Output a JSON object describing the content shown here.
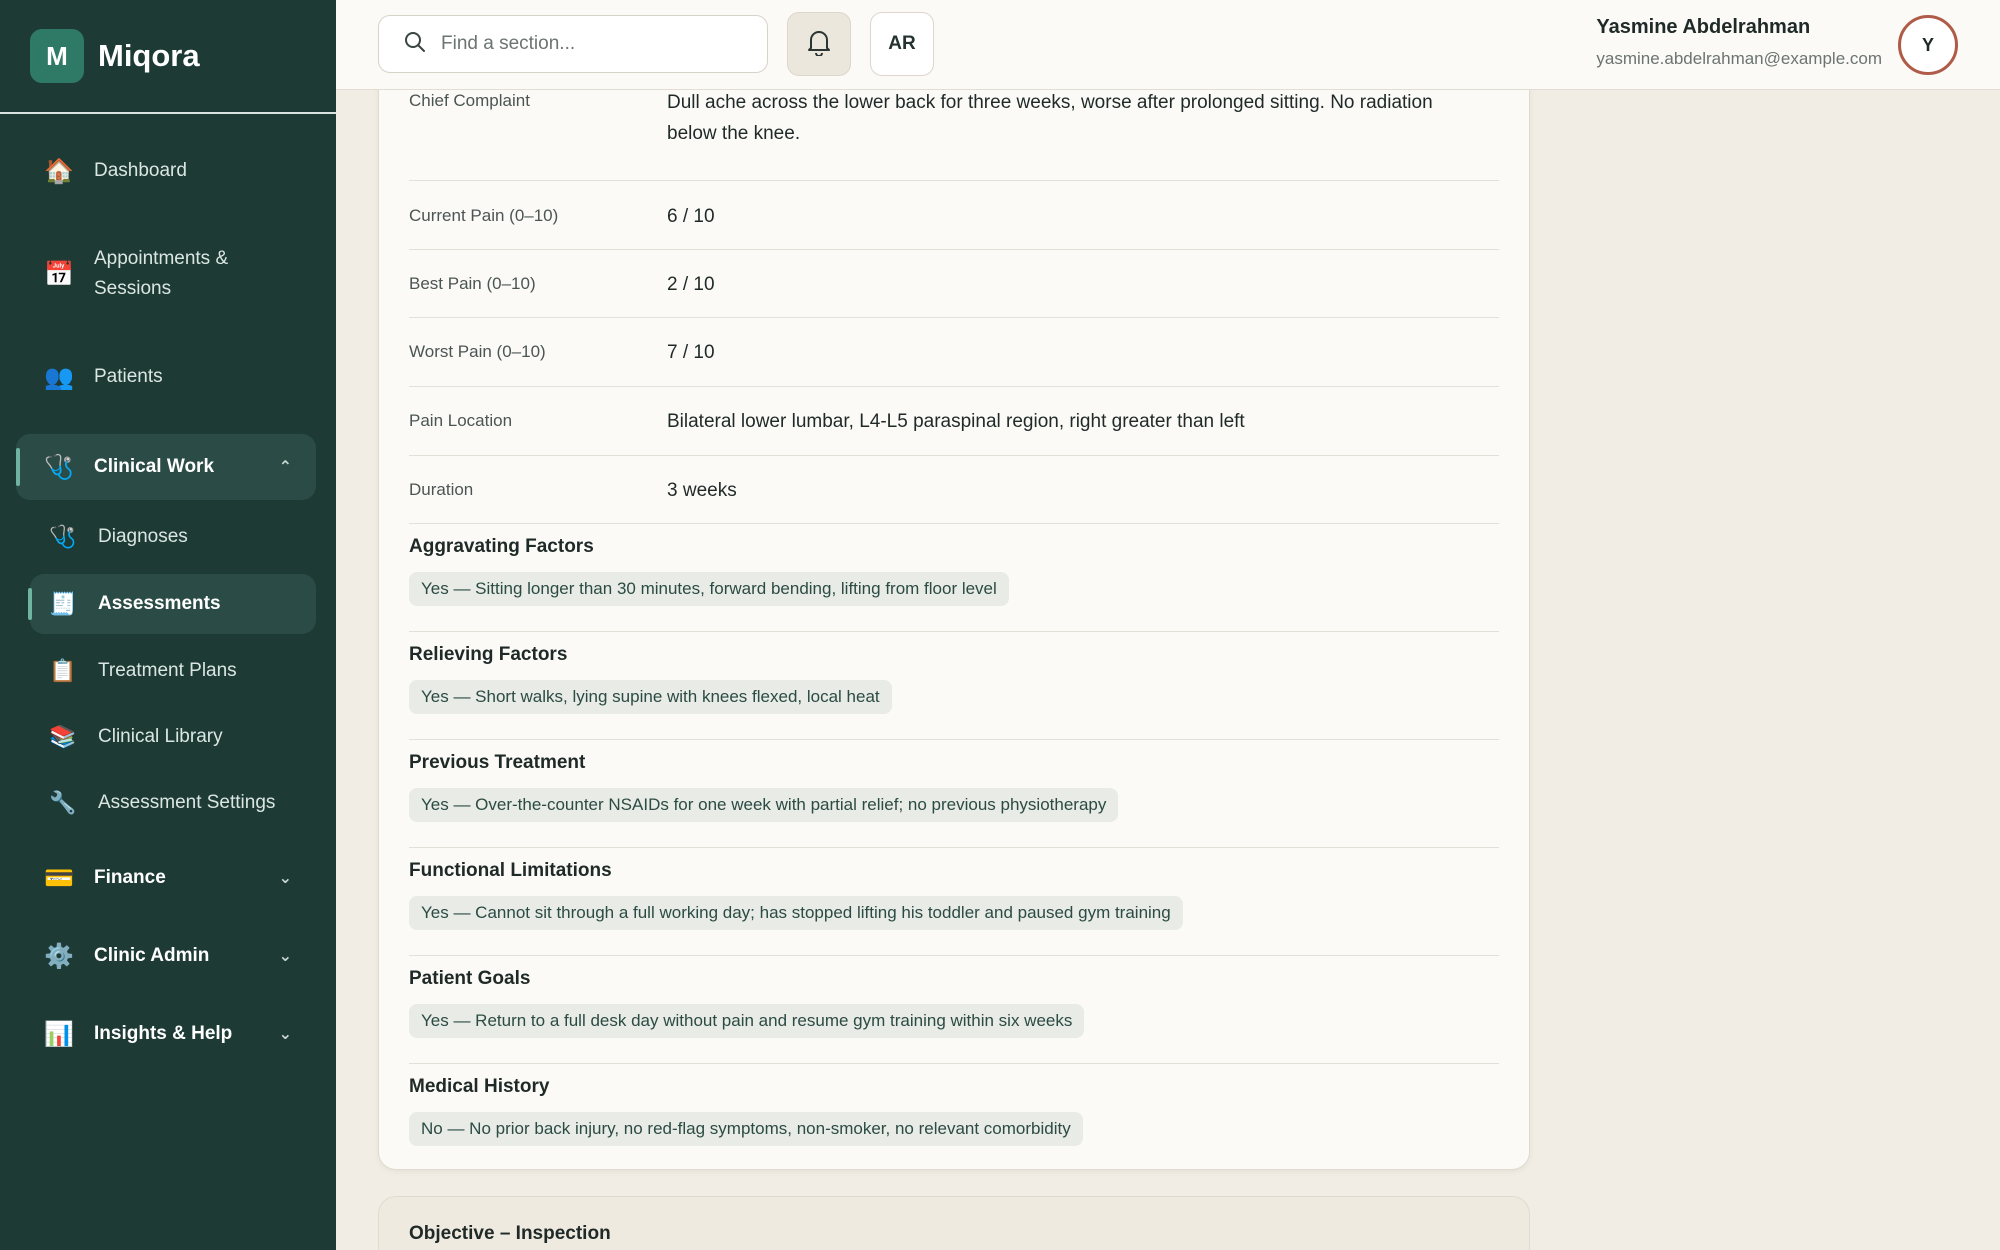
{
  "brand": {
    "mark": "M",
    "name": "Miqora"
  },
  "sidebar": {
    "items": [
      {
        "label": "Dashboard",
        "icon": "🏠"
      },
      {
        "label": "Appointments & Sessions",
        "icon": "📅"
      },
      {
        "label": "Patients",
        "icon": "👥"
      },
      {
        "label": "Clinical Work",
        "icon": "🩺",
        "chevron": "⌃"
      }
    ],
    "sub_items": [
      {
        "label": "Diagnoses",
        "icon": "🩺"
      },
      {
        "label": "Assessments",
        "icon": "🧾"
      },
      {
        "label": "Treatment Plans",
        "icon": "📋"
      },
      {
        "label": "Clinical Library",
        "icon": "📚"
      },
      {
        "label": "Assessment Settings",
        "icon": "🔧"
      }
    ],
    "groups": [
      {
        "label": "Finance",
        "icon": "💳",
        "chevron": "⌄"
      },
      {
        "label": "Clinic Admin",
        "icon": "⚙️",
        "chevron": "⌄"
      },
      {
        "label": "Insights & Help",
        "icon": "📊",
        "chevron": "⌄"
      }
    ]
  },
  "header": {
    "search_placeholder": "Find a section...",
    "lang": "AR",
    "user_name": "Yasmine Abdelrahman",
    "user_email": "yasmine.abdelrahman@example.com",
    "avatar": "Y"
  },
  "assessment": {
    "fields": [
      {
        "label": "Chief Complaint",
        "value": "Dull ache across the lower back for three weeks, worse after prolonged sitting. No radiation below the knee."
      },
      {
        "label": "Current Pain (0–10)",
        "value": "6 / 10"
      },
      {
        "label": "Best Pain (0–10)",
        "value": "2 / 10"
      },
      {
        "label": "Worst Pain (0–10)",
        "value": "7 / 10"
      },
      {
        "label": "Pain Location",
        "value": "Bilateral lower lumbar, L4-L5 paraspinal region, right greater than left"
      },
      {
        "label": "Duration",
        "value": "3 weeks"
      }
    ],
    "sections": [
      {
        "title": "Aggravating Factors",
        "answer": "Yes — Sitting longer than 30 minutes, forward bending, lifting from floor level"
      },
      {
        "title": "Relieving Factors",
        "answer": "Yes — Short walks, lying supine with knees flexed, local heat"
      },
      {
        "title": "Previous Treatment",
        "answer": "Yes — Over-the-counter NSAIDs for one week with partial relief; no previous physiotherapy"
      },
      {
        "title": "Functional Limitations",
        "answer": "Yes — Cannot sit through a full working day; has stopped lifting his toddler and paused gym training"
      },
      {
        "title": "Patient Goals",
        "answer": "Yes — Return to a full desk day without pain and resume gym training within six weeks"
      },
      {
        "title": "Medical History",
        "answer": "No — No prior back injury, no red-flag symptoms, non-smoker, no relevant comorbidity"
      }
    ],
    "next_section_title": "Objective – Inspection"
  }
}
